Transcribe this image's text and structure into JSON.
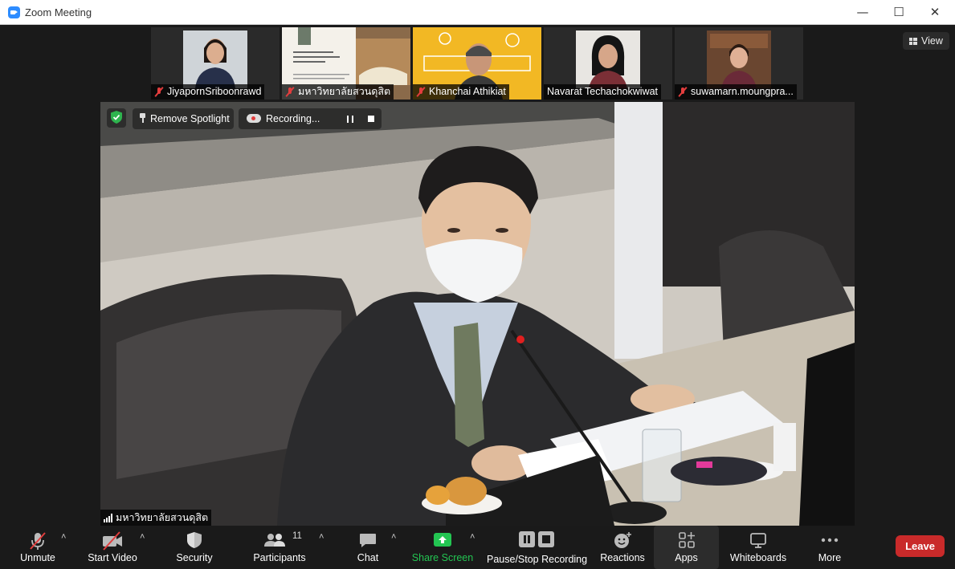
{
  "window": {
    "title": "Zoom Meeting",
    "minimize": "—",
    "maximize": "☐",
    "close": "✕"
  },
  "view_button": {
    "label": "View"
  },
  "participants_strip": [
    {
      "name": "JiyapornSriboonrawd",
      "muted": true
    },
    {
      "name": "มหาวิทยาลัยสวนดุสิต",
      "muted": true
    },
    {
      "name": "Khanchai Athikiat",
      "muted": true
    },
    {
      "name": "Navarat Techachokwiwat",
      "muted": false
    },
    {
      "name": "suwamarn.moungpra...",
      "muted": true
    }
  ],
  "main_video": {
    "overlay": {
      "remove_spotlight": "Remove Spotlight",
      "recording": "Recording..."
    },
    "speaker_name": "มหาวิทยาลัยสวนดุสิต"
  },
  "toolbar": {
    "unmute": "Unmute",
    "start_video": "Start Video",
    "security": "Security",
    "participants": "Participants",
    "participants_count": "11",
    "chat": "Chat",
    "share_screen": "Share Screen",
    "recording": "Pause/Stop Recording",
    "reactions": "Reactions",
    "apps": "Apps",
    "whiteboards": "Whiteboards",
    "more": "More",
    "leave": "Leave"
  },
  "colors": {
    "accent_green": "#23c552",
    "leave_red": "#c92a2a",
    "mute_red": "#e23d3d",
    "shield_green": "#2eb44e"
  }
}
